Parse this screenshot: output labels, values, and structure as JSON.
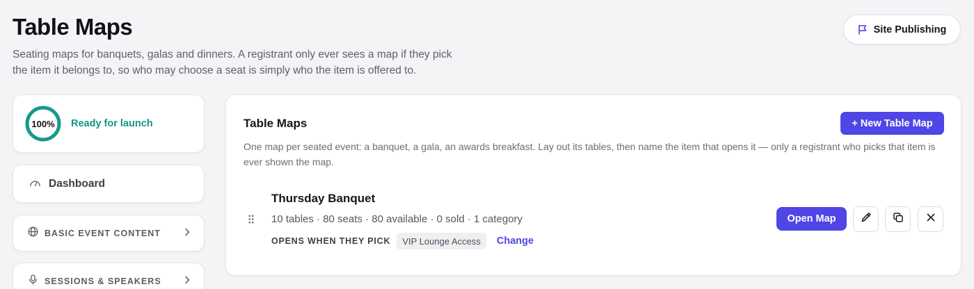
{
  "header": {
    "title": "Table Maps",
    "subtitle": "Seating maps for banquets, galas and dinners. A registrant only ever sees a map if they pick the item it belongs to, so who may choose a seat is simply who the item is offered to.",
    "publish_button": {
      "label": "Site Publishing",
      "icon": "flag-icon"
    }
  },
  "sidebar": {
    "launch": {
      "progress_percent": 100,
      "progress_label": "100%",
      "status": "Ready for launch",
      "ring_color": "#169a8a"
    },
    "dashboard": {
      "label": "Dashboard",
      "icon": "gauge-icon"
    },
    "sections": [
      {
        "label": "BASIC EVENT CONTENT",
        "icon": "globe-icon"
      },
      {
        "label": "SESSIONS & SPEAKERS",
        "icon": "microphone-icon"
      }
    ]
  },
  "main": {
    "title": "Table Maps",
    "new_button": "+ New Table Map",
    "description": "One map per seated event: a banquet, a gala, an awards breakfast. Lay out its tables, then name the item that opens it — only a registrant who picks that item is ever shown the map.",
    "maps": [
      {
        "name": "Thursday Banquet",
        "stats": "10 tables · 80 seats · 80 available · 0 sold · 1 category",
        "opens_label": "OPENS WHEN THEY PICK",
        "opens_item": "VIP Lounge Access",
        "change_label": "Change",
        "open_button": "Open Map",
        "actions": [
          "pencil-icon",
          "copy-icon",
          "close-icon"
        ]
      }
    ]
  },
  "colors": {
    "accent": "#4f46e5",
    "success": "#159486",
    "background": "#f4f4f6"
  }
}
